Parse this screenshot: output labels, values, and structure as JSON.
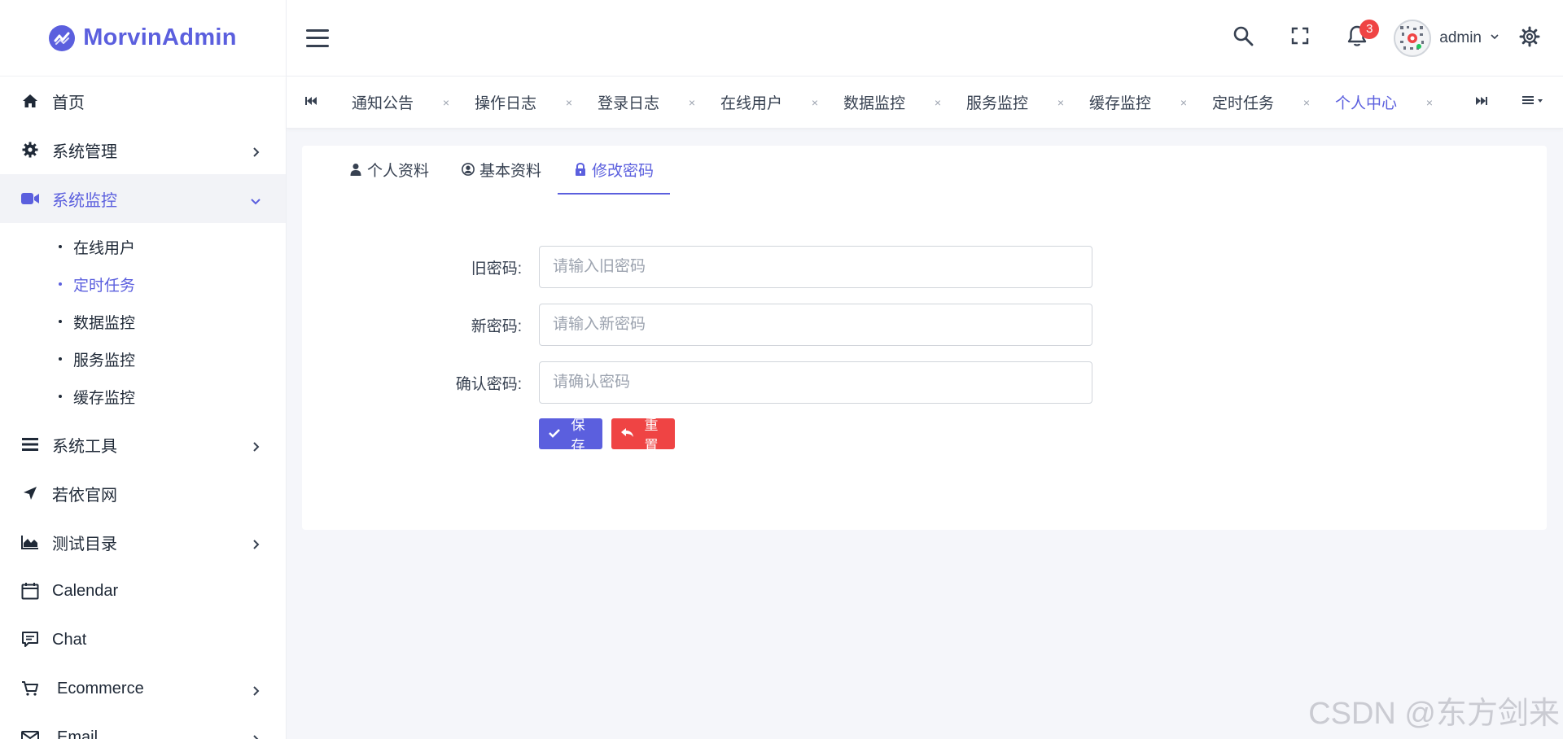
{
  "brand": {
    "name": "MorvinAdmin",
    "color": "#5b5fde"
  },
  "sidebar": {
    "items": [
      {
        "label": "首页",
        "icon": "home-icon"
      },
      {
        "label": "系统管理",
        "icon": "gear-icon"
      },
      {
        "label": "系统监控",
        "icon": "video-camera-icon"
      },
      {
        "label": "系统工具",
        "icon": "bars-icon"
      },
      {
        "label": "若依官网",
        "icon": "location-arrow-icon"
      },
      {
        "label": "测试目录",
        "icon": "area-chart-icon"
      },
      {
        "label": "Calendar",
        "icon": "calendar-icon"
      },
      {
        "label": "Chat",
        "icon": "chat-icon"
      },
      {
        "label": "Ecommerce",
        "icon": "cart-icon"
      },
      {
        "label": "Email",
        "icon": "mail-icon"
      }
    ],
    "submenu": [
      {
        "label": "在线用户"
      },
      {
        "label": "定时任务"
      },
      {
        "label": "数据监控"
      },
      {
        "label": "服务监控"
      },
      {
        "label": "缓存监控"
      }
    ]
  },
  "header": {
    "notification_count": "3",
    "username": "admin"
  },
  "tabs": [
    {
      "label": "通知公告",
      "close": "×"
    },
    {
      "label": "操作日志",
      "close": "×"
    },
    {
      "label": "登录日志",
      "close": "×"
    },
    {
      "label": "在线用户",
      "close": "×"
    },
    {
      "label": "数据监控",
      "close": "×"
    },
    {
      "label": "服务监控",
      "close": "×"
    },
    {
      "label": "缓存监控",
      "close": "×"
    },
    {
      "label": "定时任务",
      "close": "×"
    },
    {
      "label": "个人中心",
      "close": "×"
    }
  ],
  "profile_tabs": [
    {
      "label": "个人资料",
      "icon": "user-icon"
    },
    {
      "label": "基本资料",
      "icon": "user-circle-icon"
    },
    {
      "label": "修改密码",
      "icon": "lock-icon"
    }
  ],
  "form": {
    "old_label": "旧密码:",
    "old_placeholder": "请输入旧密码",
    "new_label": "新密码:",
    "new_placeholder": "请输入新密码",
    "confirm_label": "确认密码:",
    "confirm_placeholder": "请确认密码",
    "save_label": "保 存",
    "reset_label": "重 置"
  },
  "watermark": "CSDN @东方剑来"
}
